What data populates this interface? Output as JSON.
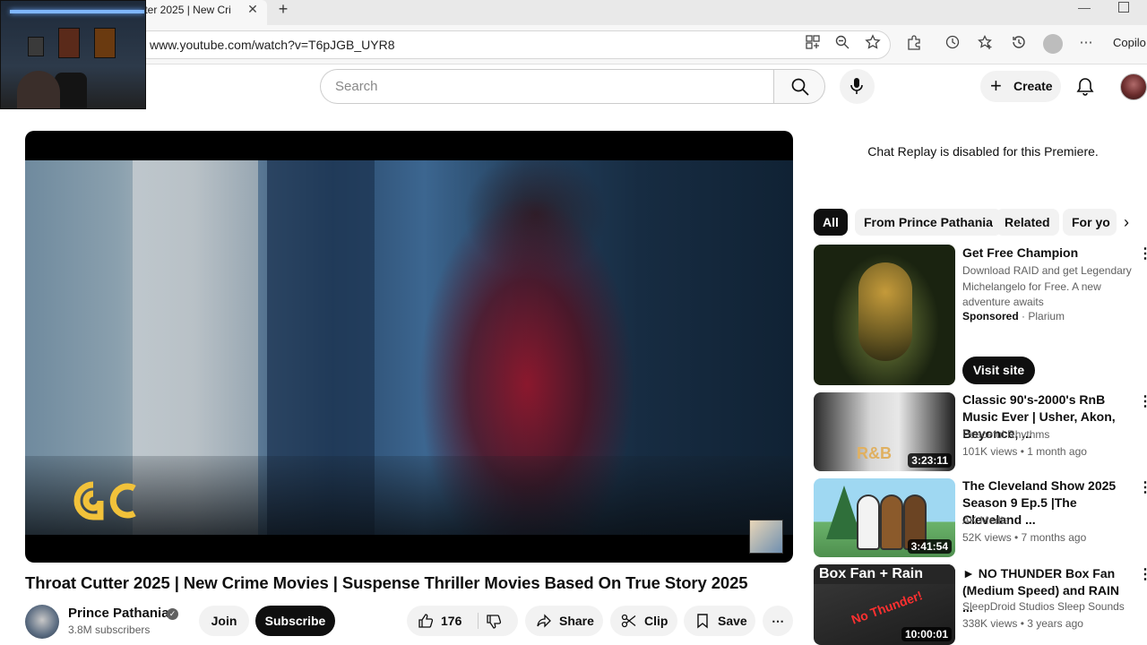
{
  "browser": {
    "tab_title": "tter 2025 | New Cri",
    "new_tab_glyph": "+",
    "close_glyph": "✕",
    "url": "www.youtube.com/watch?v=T6pJGB_UYR8",
    "copilot_label": "Copilo"
  },
  "header": {
    "search_placeholder": "Search",
    "create_label": "Create"
  },
  "video": {
    "title": "Throat Cutter 2025 | New Crime Movies | Suspense Thriller Movies Based On True Story 2025",
    "channel_name": "Prince Pathania",
    "subscribers": "3.8M subscribers",
    "join_label": "Join",
    "subscribe_label": "Subscribe",
    "like_count": "176",
    "share_label": "Share",
    "clip_label": "Clip",
    "save_label": "Save"
  },
  "sidebar": {
    "chat_message": "Chat Replay is disabled for this Premiere.",
    "chips": [
      "All",
      "From Prince Pathania",
      "Related",
      "For yo"
    ],
    "ad": {
      "title": "Get Free Champion",
      "description": "Download RAID and get Legendary Michelangelo for Free. A new adventure awaits",
      "sponsored": "Sponsored",
      "advertiser": "Plarium",
      "cta": "Visit site"
    },
    "recommendations": [
      {
        "title": "Classic 90's-2000's RnB Music Ever | Usher, Akon, Beyonce, ...",
        "channel": "Peaceful Rhythms",
        "meta": "101K views • 1 month ago",
        "duration": "3:23:11",
        "thumb_text": "R&B"
      },
      {
        "title": "The Cleveland Show 2025 Season 9 Ep.5 |The Cleveland ...",
        "channel": "AK Media",
        "meta": "52K views • 7 months ago",
        "duration": "3:41:54"
      },
      {
        "title": "► NO THUNDER Box Fan (Medium Speed) and RAIN ...",
        "channel": "SleepDroid Studios Sleep Sounds",
        "meta": "338K views • 3 years ago",
        "duration": "10:00:01",
        "thumb_text": "Box Fan + Rain",
        "thumb_red": "No Thunder!"
      }
    ]
  },
  "colors": {
    "accent_dark": "#0f0f0f",
    "chip_bg": "#f2f2f2",
    "meta_text": "#606060",
    "logo_gold": "#f2c23a"
  }
}
